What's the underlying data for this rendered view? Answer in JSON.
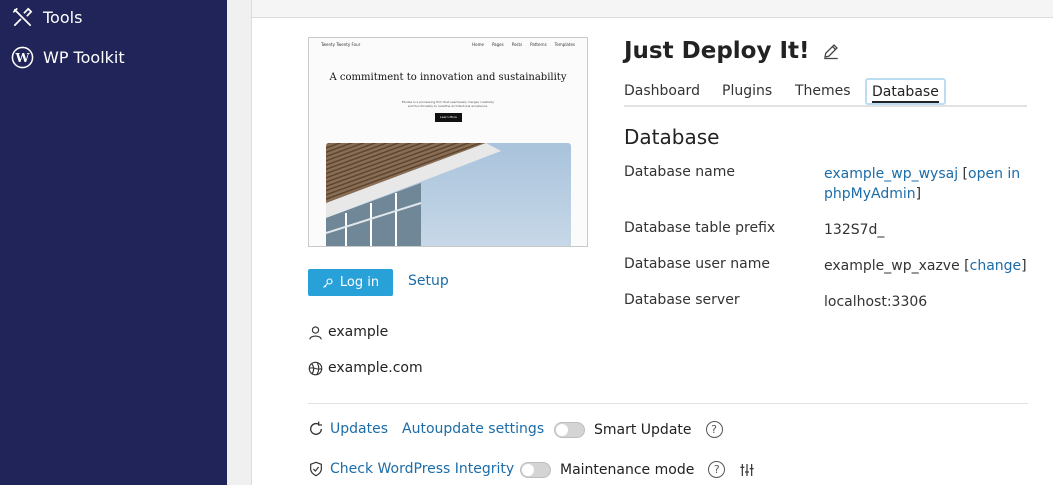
{
  "sidebar": {
    "items": [
      {
        "label": "Tools",
        "icon": "tools-icon"
      },
      {
        "label": "WP Toolkit",
        "icon": "wordpress-icon"
      }
    ]
  },
  "preview": {
    "brand": "Twenty Twenty Four",
    "nav": [
      "Home",
      "Pages",
      "Posts",
      "Patterns",
      "Templates"
    ],
    "headline": "A commitment to innovation and sustainability",
    "subtext": "Études is a pioneering firm that seamlessly merges creativity and functionality to redefine architectural excellence.",
    "cta": "Learn More"
  },
  "actions": {
    "login_label": "Log in",
    "setup_label": "Setup"
  },
  "meta": {
    "user": "example",
    "domain": "example.com"
  },
  "site": {
    "title": "Just Deploy It!"
  },
  "tabs": [
    {
      "label": "Dashboard"
    },
    {
      "label": "Plugins"
    },
    {
      "label": "Themes"
    },
    {
      "label": "Database",
      "active": true
    }
  ],
  "database": {
    "heading": "Database",
    "name_label": "Database name",
    "name_value": "example_wp_wysaj",
    "open_link_prefix": "[",
    "open_link": "open in phpMyAdmin",
    "open_link_suffix": "]",
    "prefix_label": "Database table prefix",
    "prefix_value": "132S7d_",
    "user_label": "Database user name",
    "user_value": "example_wp_xazve",
    "change_prefix": "[",
    "change_link": "change",
    "change_suffix": "]",
    "server_label": "Database server",
    "server_value": "localhost:3306"
  },
  "bottom": {
    "updates": "Updates",
    "autoupdate": "Autoupdate settings",
    "smart_update": "Smart Update",
    "check_integrity": "Check WordPress Integrity",
    "maintenance": "Maintenance mode",
    "help_glyph": "?"
  },
  "colors": {
    "sidebar_bg": "#212458",
    "primary_button": "#28a1d9",
    "link": "#1b6ca8"
  }
}
